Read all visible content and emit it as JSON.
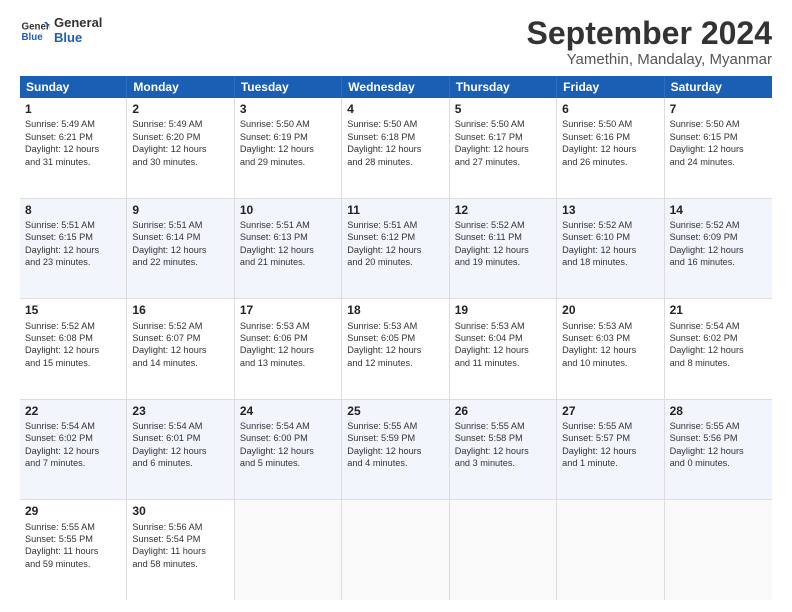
{
  "header": {
    "logo_line1": "General",
    "logo_line2": "Blue",
    "title": "September 2024",
    "subtitle": "Yamethin, Mandalay, Myanmar"
  },
  "calendar": {
    "days_of_week": [
      "Sunday",
      "Monday",
      "Tuesday",
      "Wednesday",
      "Thursday",
      "Friday",
      "Saturday"
    ],
    "rows": [
      [
        {
          "day": "1",
          "lines": [
            "Sunrise: 5:49 AM",
            "Sunset: 6:21 PM",
            "Daylight: 12 hours",
            "and 31 minutes."
          ]
        },
        {
          "day": "2",
          "lines": [
            "Sunrise: 5:49 AM",
            "Sunset: 6:20 PM",
            "Daylight: 12 hours",
            "and 30 minutes."
          ]
        },
        {
          "day": "3",
          "lines": [
            "Sunrise: 5:50 AM",
            "Sunset: 6:19 PM",
            "Daylight: 12 hours",
            "and 29 minutes."
          ]
        },
        {
          "day": "4",
          "lines": [
            "Sunrise: 5:50 AM",
            "Sunset: 6:18 PM",
            "Daylight: 12 hours",
            "and 28 minutes."
          ]
        },
        {
          "day": "5",
          "lines": [
            "Sunrise: 5:50 AM",
            "Sunset: 6:17 PM",
            "Daylight: 12 hours",
            "and 27 minutes."
          ]
        },
        {
          "day": "6",
          "lines": [
            "Sunrise: 5:50 AM",
            "Sunset: 6:16 PM",
            "Daylight: 12 hours",
            "and 26 minutes."
          ]
        },
        {
          "day": "7",
          "lines": [
            "Sunrise: 5:50 AM",
            "Sunset: 6:15 PM",
            "Daylight: 12 hours",
            "and 24 minutes."
          ]
        }
      ],
      [
        {
          "day": "8",
          "lines": [
            "Sunrise: 5:51 AM",
            "Sunset: 6:15 PM",
            "Daylight: 12 hours",
            "and 23 minutes."
          ]
        },
        {
          "day": "9",
          "lines": [
            "Sunrise: 5:51 AM",
            "Sunset: 6:14 PM",
            "Daylight: 12 hours",
            "and 22 minutes."
          ]
        },
        {
          "day": "10",
          "lines": [
            "Sunrise: 5:51 AM",
            "Sunset: 6:13 PM",
            "Daylight: 12 hours",
            "and 21 minutes."
          ]
        },
        {
          "day": "11",
          "lines": [
            "Sunrise: 5:51 AM",
            "Sunset: 6:12 PM",
            "Daylight: 12 hours",
            "and 20 minutes."
          ]
        },
        {
          "day": "12",
          "lines": [
            "Sunrise: 5:52 AM",
            "Sunset: 6:11 PM",
            "Daylight: 12 hours",
            "and 19 minutes."
          ]
        },
        {
          "day": "13",
          "lines": [
            "Sunrise: 5:52 AM",
            "Sunset: 6:10 PM",
            "Daylight: 12 hours",
            "and 18 minutes."
          ]
        },
        {
          "day": "14",
          "lines": [
            "Sunrise: 5:52 AM",
            "Sunset: 6:09 PM",
            "Daylight: 12 hours",
            "and 16 minutes."
          ]
        }
      ],
      [
        {
          "day": "15",
          "lines": [
            "Sunrise: 5:52 AM",
            "Sunset: 6:08 PM",
            "Daylight: 12 hours",
            "and 15 minutes."
          ]
        },
        {
          "day": "16",
          "lines": [
            "Sunrise: 5:52 AM",
            "Sunset: 6:07 PM",
            "Daylight: 12 hours",
            "and 14 minutes."
          ]
        },
        {
          "day": "17",
          "lines": [
            "Sunrise: 5:53 AM",
            "Sunset: 6:06 PM",
            "Daylight: 12 hours",
            "and 13 minutes."
          ]
        },
        {
          "day": "18",
          "lines": [
            "Sunrise: 5:53 AM",
            "Sunset: 6:05 PM",
            "Daylight: 12 hours",
            "and 12 minutes."
          ]
        },
        {
          "day": "19",
          "lines": [
            "Sunrise: 5:53 AM",
            "Sunset: 6:04 PM",
            "Daylight: 12 hours",
            "and 11 minutes."
          ]
        },
        {
          "day": "20",
          "lines": [
            "Sunrise: 5:53 AM",
            "Sunset: 6:03 PM",
            "Daylight: 12 hours",
            "and 10 minutes."
          ]
        },
        {
          "day": "21",
          "lines": [
            "Sunrise: 5:54 AM",
            "Sunset: 6:02 PM",
            "Daylight: 12 hours",
            "and 8 minutes."
          ]
        }
      ],
      [
        {
          "day": "22",
          "lines": [
            "Sunrise: 5:54 AM",
            "Sunset: 6:02 PM",
            "Daylight: 12 hours",
            "and 7 minutes."
          ]
        },
        {
          "day": "23",
          "lines": [
            "Sunrise: 5:54 AM",
            "Sunset: 6:01 PM",
            "Daylight: 12 hours",
            "and 6 minutes."
          ]
        },
        {
          "day": "24",
          "lines": [
            "Sunrise: 5:54 AM",
            "Sunset: 6:00 PM",
            "Daylight: 12 hours",
            "and 5 minutes."
          ]
        },
        {
          "day": "25",
          "lines": [
            "Sunrise: 5:55 AM",
            "Sunset: 5:59 PM",
            "Daylight: 12 hours",
            "and 4 minutes."
          ]
        },
        {
          "day": "26",
          "lines": [
            "Sunrise: 5:55 AM",
            "Sunset: 5:58 PM",
            "Daylight: 12 hours",
            "and 3 minutes."
          ]
        },
        {
          "day": "27",
          "lines": [
            "Sunrise: 5:55 AM",
            "Sunset: 5:57 PM",
            "Daylight: 12 hours",
            "and 1 minute."
          ]
        },
        {
          "day": "28",
          "lines": [
            "Sunrise: 5:55 AM",
            "Sunset: 5:56 PM",
            "Daylight: 12 hours",
            "and 0 minutes."
          ]
        }
      ],
      [
        {
          "day": "29",
          "lines": [
            "Sunrise: 5:55 AM",
            "Sunset: 5:55 PM",
            "Daylight: 11 hours",
            "and 59 minutes."
          ]
        },
        {
          "day": "30",
          "lines": [
            "Sunrise: 5:56 AM",
            "Sunset: 5:54 PM",
            "Daylight: 11 hours",
            "and 58 minutes."
          ]
        },
        {
          "day": "",
          "lines": []
        },
        {
          "day": "",
          "lines": []
        },
        {
          "day": "",
          "lines": []
        },
        {
          "day": "",
          "lines": []
        },
        {
          "day": "",
          "lines": []
        }
      ]
    ]
  }
}
